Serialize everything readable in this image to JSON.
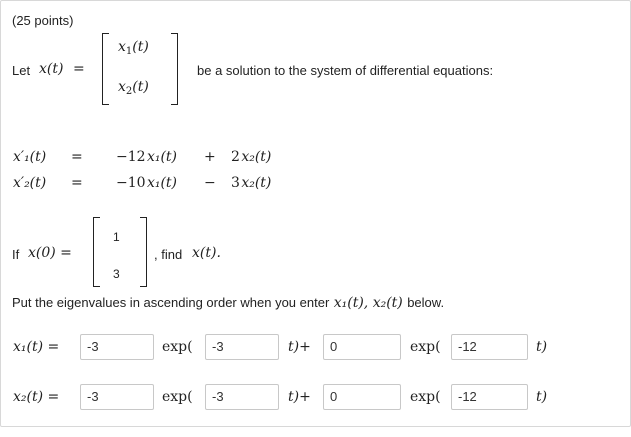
{
  "points": "(25 points)",
  "intro": {
    "let_label": "Let",
    "x_t": "x(t)",
    "eq": "=",
    "x1_t": "t",
    "x2_t": "t",
    "after": "be a solution to the system of differential equations:"
  },
  "system": {
    "row1": {
      "lhs": "x′₁(t)",
      "eq": "=",
      "c1": "−12",
      "v1": "x₁(t)",
      "sign": "+",
      "c2": "2",
      "v2": "x₂(t)"
    },
    "row2": {
      "lhs": "x′₂(t)",
      "eq": "=",
      "c1": "−10",
      "v1": "x₁(t)",
      "sign": "−",
      "c2": "3",
      "v2": "x₂(t)"
    }
  },
  "initial": {
    "if_label": "If",
    "lhs": "x(0) =",
    "v1": "1",
    "v2": "3",
    "find": ", find",
    "find_var": "x(t)."
  },
  "instruction": {
    "text_before": "Put the eigenvalues in ascending order when you enter",
    "vars": "x₁(t), x₂(t)",
    "text_after": "below."
  },
  "answers": {
    "row1": {
      "lhs": "x₁(t) =",
      "coef1": "-3",
      "exp1": "exp(",
      "eig1": "-3",
      "mid": "t)+",
      "coef2": "0",
      "exp2": "exp(",
      "eig2": "-12",
      "end": "t)"
    },
    "row2": {
      "lhs": "x₂(t) =",
      "coef1": "-3",
      "exp1": "exp(",
      "eig1": "-3",
      "mid": "t)+",
      "coef2": "0",
      "exp2": "exp(",
      "eig2": "-12",
      "end": "t)"
    }
  }
}
